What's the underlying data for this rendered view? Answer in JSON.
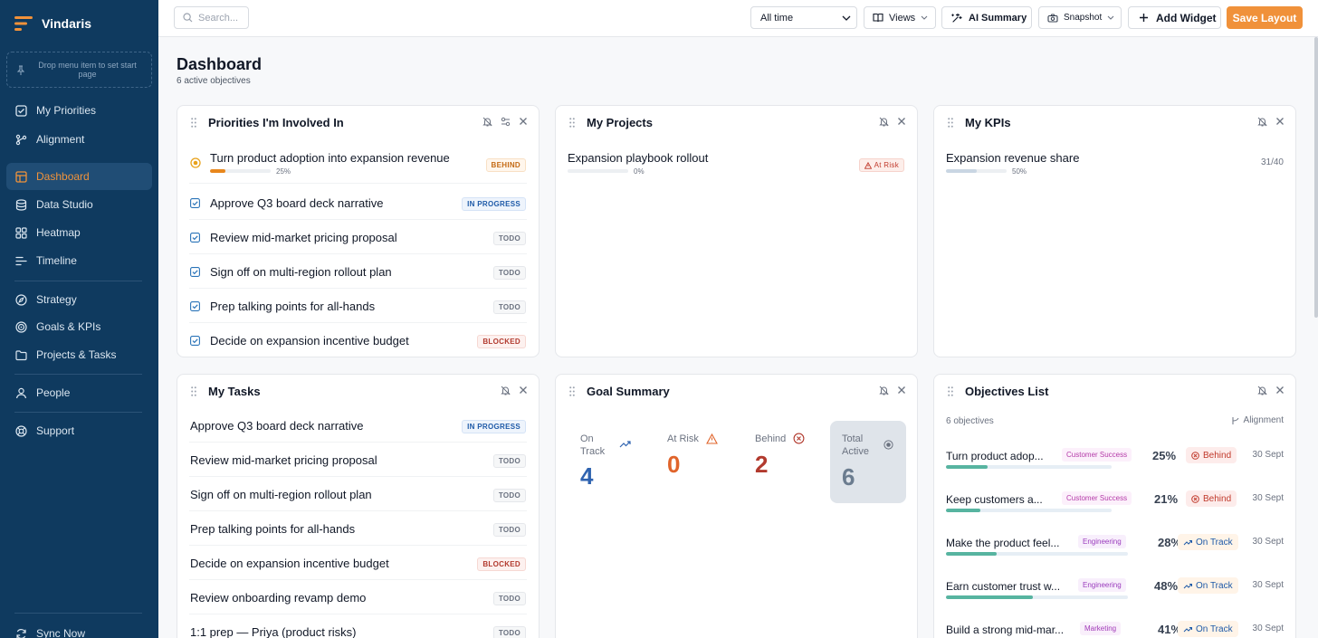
{
  "app": {
    "name": "Vindaris"
  },
  "sidebar": {
    "drop_hint": "Drop menu item to set start page",
    "items": [
      {
        "label": "My Priorities",
        "icon": "checkbox-icon"
      },
      {
        "label": "Alignment",
        "icon": "branch-icon"
      },
      {
        "label": "Dashboard",
        "icon": "grid-icon",
        "active": true
      },
      {
        "label": "Data Studio",
        "icon": "database-icon"
      },
      {
        "label": "Heatmap",
        "icon": "layout-icon"
      },
      {
        "label": "Timeline",
        "icon": "timeline-icon"
      },
      {
        "label": "Strategy",
        "icon": "compass-icon"
      },
      {
        "label": "Goals & KPIs",
        "icon": "target-icon"
      },
      {
        "label": "Projects & Tasks",
        "icon": "folder-icon"
      },
      {
        "label": "People",
        "icon": "user-icon"
      },
      {
        "label": "Support",
        "icon": "support-icon"
      },
      {
        "label": "Sync Now",
        "icon": "sync-icon"
      }
    ]
  },
  "topbar": {
    "search_placeholder": "Search...",
    "time_filter": "All time",
    "views": "Views",
    "ai_summary": "AI Summary",
    "snapshot": "Snapshot",
    "add_widget": "Add Widget",
    "save_layout": "Save Layout"
  },
  "page": {
    "title": "Dashboard",
    "subtitle": "6 active objectives"
  },
  "priorities": {
    "title": "Priorities I'm Involved In",
    "top": {
      "title": "Turn product adoption into expansion revenue",
      "progress": 0.25,
      "progress_label": "25%",
      "status": "BEHIND"
    },
    "rows": [
      {
        "title": "Approve Q3 board deck narrative",
        "status": "IN PROGRESS"
      },
      {
        "title": "Review mid-market pricing proposal",
        "status": "TODO"
      },
      {
        "title": "Sign off on multi-region rollout plan",
        "status": "TODO"
      },
      {
        "title": "Prep talking points for all-hands",
        "status": "TODO"
      },
      {
        "title": "Decide on expansion incentive budget",
        "status": "BLOCKED"
      }
    ]
  },
  "projects": {
    "title": "My Projects",
    "items": [
      {
        "title": "Expansion playbook rollout",
        "progress": 0,
        "progress_label": "0%",
        "status": "At Risk"
      }
    ]
  },
  "kpis": {
    "title": "My KPIs",
    "items": [
      {
        "title": "Expansion revenue share",
        "progress": 0.5,
        "progress_label": "50%",
        "value": "31/40"
      }
    ]
  },
  "tasks": {
    "title": "My Tasks",
    "rows": [
      {
        "title": "Approve Q3 board deck narrative",
        "status": "IN PROGRESS"
      },
      {
        "title": "Review mid-market pricing proposal",
        "status": "TODO"
      },
      {
        "title": "Sign off on multi-region rollout plan",
        "status": "TODO"
      },
      {
        "title": "Prep talking points for all-hands",
        "status": "TODO"
      },
      {
        "title": "Decide on expansion incentive budget",
        "status": "BLOCKED"
      },
      {
        "title": "Review onboarding revamp demo",
        "status": "TODO"
      },
      {
        "title": "1:1 prep — Priya (product risks)",
        "status": "TODO"
      }
    ]
  },
  "goal_summary": {
    "title": "Goal Summary",
    "on_track": {
      "label_1": "On",
      "label_2": "Track",
      "value": "4"
    },
    "at_risk": {
      "label": "At Risk",
      "value": "0"
    },
    "behind": {
      "label": "Behind",
      "value": "2"
    },
    "total": {
      "label_1": "Total",
      "label_2": "Active",
      "value": "6"
    }
  },
  "objectives": {
    "title": "Objectives List",
    "count_label": "6 objectives",
    "alignment_link": "Alignment",
    "rows": [
      {
        "title": "Turn product adoption into expansion revenue",
        "display_title": "Turn product adop...",
        "tag": "Customer Success",
        "pct": "25%",
        "progress": 0.25,
        "status": "Behind",
        "date": "30 Sept"
      },
      {
        "title": "Keep customers around",
        "display_title": "Keep customers a...",
        "tag": "Customer Success",
        "pct": "21%",
        "progress": 0.21,
        "status": "Behind",
        "date": "30 Sept"
      },
      {
        "title": "Make the product feel",
        "display_title": "Make the product feel...",
        "tag": "Engineering",
        "pct": "28%",
        "progress": 0.28,
        "status": "On Track",
        "date": "30 Sept"
      },
      {
        "title": "Earn customer trust w",
        "display_title": "Earn customer trust w...",
        "tag": "Engineering",
        "pct": "48%",
        "progress": 0.48,
        "status": "On Track",
        "date": "30 Sept"
      },
      {
        "title": "Build a strong mid-mar",
        "display_title": "Build a strong mid-mar...",
        "tag": "Marketing",
        "pct": "41%",
        "progress": 0.41,
        "status": "On Track",
        "date": "30 Sept"
      }
    ]
  },
  "colors": {
    "accent": "#f0913a",
    "sidebar": "#0f3a5f",
    "on_track": "#2f63b0",
    "behind": "#b23a2e",
    "progress": "#57b4a0"
  }
}
